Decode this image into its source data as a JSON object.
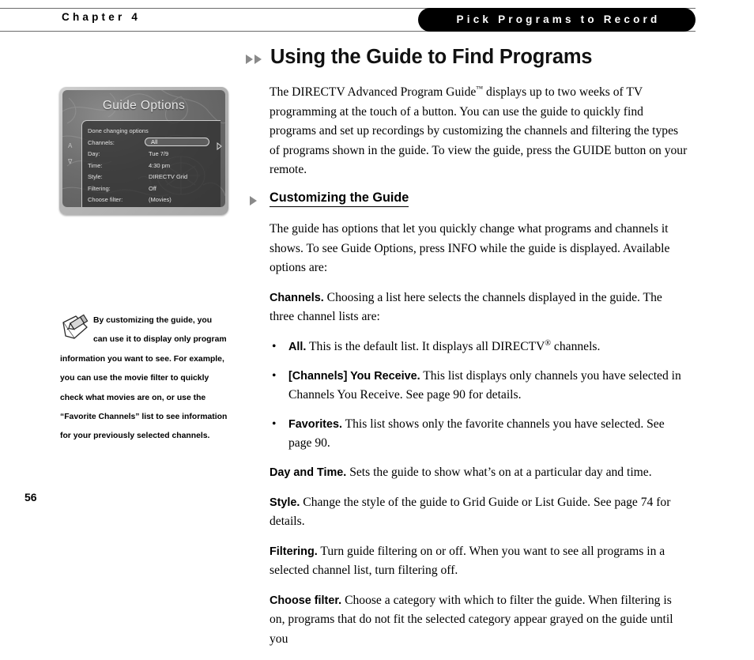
{
  "header": {
    "chapter_label": "Chapter 4",
    "section_tab": "Pick Programs to Record"
  },
  "title": {
    "main": "Using the Guide to Find Programs",
    "bullet_icon": "double-triangle-right-icon"
  },
  "tv_figure": {
    "screen_title": "Guide Options",
    "panel_rows": [
      {
        "label": "Done changing options",
        "value": ""
      },
      {
        "label": "Channels:",
        "value": "All",
        "selected": true
      },
      {
        "label": "Day:",
        "value": "Tue 7/9"
      },
      {
        "label": "Time:",
        "value": "4:30 pm"
      },
      {
        "label": "Style:",
        "value": "DIRECTV Grid"
      },
      {
        "label": "Filtering:",
        "value": "Off"
      },
      {
        "label": "Choose filter:",
        "value": "(Movies)"
      }
    ],
    "side_glyph_top": "A",
    "side_glyph_bottom": "∇"
  },
  "side_note": {
    "icon": "pencil-note-icon",
    "text": "By customizing the guide, you can use it to display only program information you want to see. For example, you can use the movie filter to quickly check what movies are on, or use the “Favorite Channels” list to see information for your previously selected channels."
  },
  "body": {
    "intro_para": {
      "pre_tm": "The DIRECTV Advanced Program Guide",
      "tm": "™",
      "post_tm": " displays up to two weeks of TV programming at the touch of a button. You can use the guide to quickly find programs and set up recordings by customizing the channels and filtering the types of programs shown in the guide. To view the guide, press the GUIDE button on your remote."
    },
    "subhead": "Customizing the Guide",
    "subhead_bullet_icon": "triangle-right-icon",
    "options_intro": "The guide has options that let you quickly change what programs and channels it shows. To see Guide Options, press INFO while the guide is displayed. Available options are:",
    "channels_runin": "Channels.",
    "channels_body": " Choosing a list here selects the channels displayed in the guide. The three channel lists are:",
    "bullets": [
      {
        "marker": "•",
        "runin": "All.",
        "pre_reg": " This is the default list. It displays all DIRECTV",
        "reg": "®",
        "post_reg": " channels."
      },
      {
        "marker": "•",
        "runin": "[Channels] You Receive.",
        "pre_reg": " This list displays only channels you have selected in Channels You Receive. See page 90 for details.",
        "reg": "",
        "post_reg": ""
      },
      {
        "marker": "•",
        "runin": "Favorites.",
        "pre_reg": " This list shows only the favorite channels you have selected. See page 90.",
        "reg": "",
        "post_reg": ""
      }
    ],
    "paras": [
      {
        "runin": "Day and Time.",
        "text": " Sets the guide to show what’s on at a particular day and time."
      },
      {
        "runin": "Style.",
        "text": " Change the style of the guide to Grid Guide or List Guide. See page 74 for details."
      },
      {
        "runin": "Filtering.",
        "text": " Turn guide filtering on or off. When you want to see all programs in a selected channel list, turn filtering off."
      },
      {
        "runin": "Choose filter.",
        "text": " Choose a category with which to filter the guide. When filtering is on, programs that do not fit the selected category appear grayed on the guide until you"
      }
    ]
  },
  "footer": {
    "page_number": "56"
  },
  "colors": {
    "accent_gray": "#8a8a8a",
    "tab_background": "#000000",
    "tab_text": "#ffffff",
    "rule": "#6b6b6b"
  }
}
